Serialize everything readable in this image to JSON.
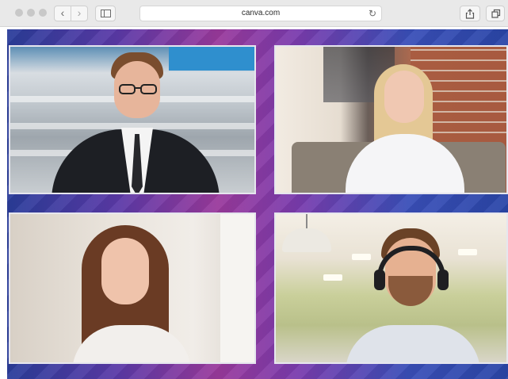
{
  "browser": {
    "url": "canva.com",
    "icons": {
      "back": "chevron-left-icon",
      "forward": "chevron-right-icon",
      "sidebar": "sidebar-icon",
      "reload": "reload-icon",
      "share": "share-icon",
      "tabs": "tabs-overview-icon"
    }
  },
  "participants": [
    {
      "description_icon": "video-tile"
    },
    {
      "description_icon": "video-tile"
    },
    {
      "description_icon": "video-tile"
    },
    {
      "description_icon": "video-tile"
    }
  ],
  "colors": {
    "chrome": "#e9e9e9",
    "canvas_left": "#2a3d9a",
    "canvas_mid": "#9a3a9c",
    "canvas_right": "#2a46a8"
  }
}
